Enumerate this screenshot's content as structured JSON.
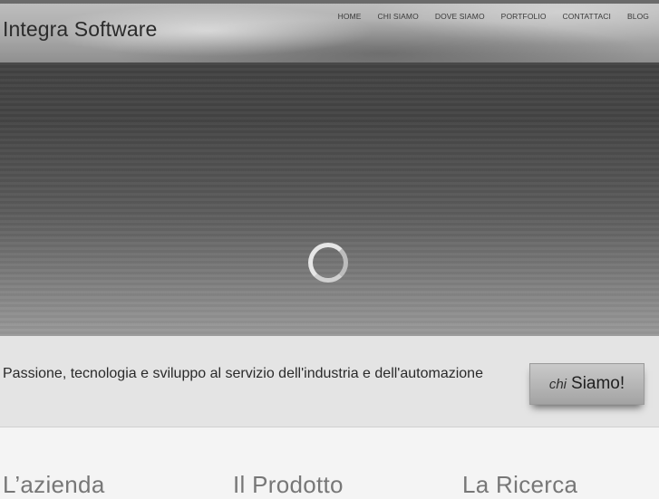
{
  "header": {
    "brand": "Integra Software",
    "nav": [
      "HOME",
      "CHI SIAMO",
      "DOVE SIAMO",
      "PORTFOLIO",
      "CONTATTACI",
      "BLOG"
    ]
  },
  "tagline": {
    "text": "Passione, tecnologia e sviluppo al servizio dell'industria e dell'automazione",
    "cta_light": "chi",
    "cta_bold": "Siamo!"
  },
  "features": {
    "items": [
      "L’azienda",
      "Il Prodotto",
      "La Ricerca"
    ]
  }
}
